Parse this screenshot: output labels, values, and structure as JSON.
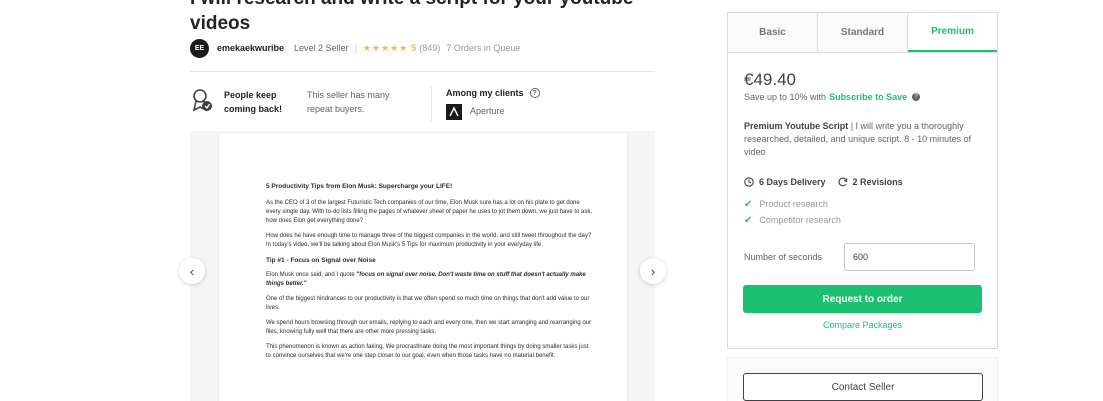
{
  "gig": {
    "title": "I will research and write a script for your youtube videos"
  },
  "seller": {
    "avatar_initials": "EE",
    "name": "emekaekwuribe",
    "level": "Level 2 Seller",
    "separator": "|",
    "stars": "★★★★★",
    "rating": "5",
    "reviews": "(849)",
    "queue": "7 Orders in Queue"
  },
  "highlights": {
    "repeat_title": "People keep coming back!",
    "repeat_text": "This seller has many repeat buyers.",
    "clients_title": "Among my clients",
    "client_logo_letter": "A",
    "client_name": "Aperture"
  },
  "document": {
    "heading": "5 Productivity Tips from Elon Musk: Supercharge your LIFE!",
    "p1": "As the CEO of 3 of the largest Futuristic Tech companies of our time, Elon Musk sure has a lot on his plate to get done every single day. With to-do lists filling the pages of whatever sheet of paper he uses to jot them down, we just have to ask, how does Elon get everything done?",
    "p2": "How does he have enough time to manage three of the biggest companies in the world, and still tweet throughout the day? In today's video, we'll be talking about Elon Musk's 5 Tips for maximum productivity in your everyday life.",
    "tip1": "Tip #1 - Focus on Signal over Noise",
    "p3_lead": "Elon Musk once said, and I quote",
    "p3_quote": "\"focus on signal over noise. Don't waste time on stuff that doesn't actually make things better.\"",
    "p4": "One of the biggest hindrances to our productivity is that we often spend so much time on things that don't add value to our lives.",
    "p5": "We spend hours browsing through our emails, replying to each and every one, then we start arranging and rearranging our files, knowing fully well that there are other more pressing tasks.",
    "p6": "This phenomenon is known as action faking. We procrastinate doing the most important things by doing smaller tasks just to convince ourselves that we're one step closer to our goal, even when those tasks have no material benefit."
  },
  "gallery": {
    "prev_label": "‹",
    "next_label": "›"
  },
  "package": {
    "tabs": [
      {
        "label": "Basic"
      },
      {
        "label": "Standard"
      },
      {
        "label": "Premium"
      }
    ],
    "active_tab": "Premium",
    "price": "€49.40",
    "save_text": "Save up to 10% with",
    "save_link": "Subscribe to Save",
    "save_help": "?",
    "desc_title": "Premium Youtube Script",
    "desc_text": "I will write you a thoroughly researched, detailed, and unique script. 8 - 10 minutes of video",
    "delivery": "6 Days Delivery",
    "revisions": "2 Revisions",
    "features": [
      {
        "label": "Product research"
      },
      {
        "label": "Competitor research"
      }
    ],
    "seconds_label": "Number of seconds",
    "seconds_value": "600",
    "order_button": "Request to order",
    "compare_link": "Compare Packages"
  },
  "contact": {
    "button": "Contact Seller"
  },
  "colors": {
    "accent": "#1dbf73",
    "star": "#ffb33e"
  }
}
